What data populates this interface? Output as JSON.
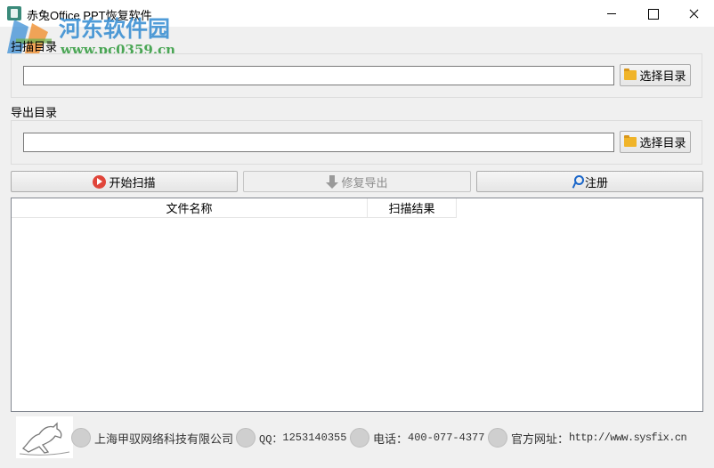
{
  "window": {
    "title": "赤兔Office PPT恢复软件"
  },
  "watermark": {
    "name": "河东软件园",
    "url": "www.pc0359.cn"
  },
  "scan_section": {
    "label": "扫描目录",
    "input_value": "",
    "browse_label": "选择目录"
  },
  "export_section": {
    "label": "导出目录",
    "input_value": "",
    "browse_label": "选择目录"
  },
  "actions": {
    "start_scan": "开始扫描",
    "repair_export": "修复导出",
    "register": "注册"
  },
  "file_list": {
    "columns": [
      "文件名称",
      "扫描结果"
    ],
    "rows": []
  },
  "footer": {
    "company": "上海甲驭网络科技有限公司",
    "qq_label": "QQ：",
    "qq": "1253140355",
    "phone_label": "电话：",
    "phone": "400-077-4377",
    "website_label": "官方网址：",
    "website": "http://www.sysfix.cn"
  },
  "colors": {
    "accent_play": "#e0453a",
    "key": "#1a66c9",
    "folder": "#f0b429",
    "watermark_blue": "#2a87d0",
    "watermark_green": "#2e9a3a"
  }
}
